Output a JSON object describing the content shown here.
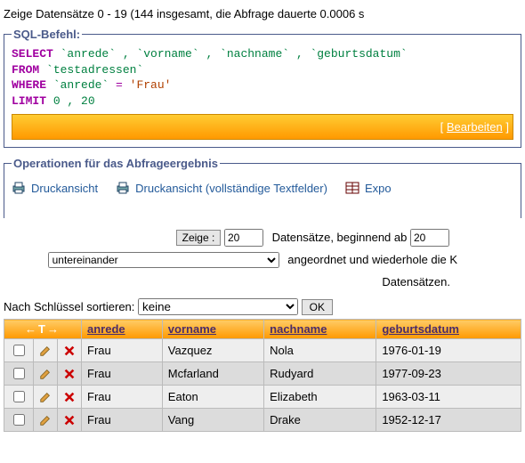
{
  "summary": "Zeige Datensätze 0 - 19 (144 insgesamt, die Abfrage dauerte 0.0006 s",
  "sql_box": {
    "legend": "SQL-Befehl:",
    "kw_select": "SELECT",
    "fields_part": " `anrede` , `vorname` , `nachname` , `geburtsdatum`",
    "kw_from": "FROM",
    "from_ident": " `testadressen`",
    "kw_where": "WHERE",
    "where_ident": " `anrede` ",
    "where_op": "=",
    "where_str": " 'Frau'",
    "kw_limit": "LIMIT",
    "limit_vals": " 0 , 20",
    "edit_bracket_open": "[ ",
    "edit_link": "Bearbeiten",
    "edit_bracket_close": " ]"
  },
  "ops": {
    "legend": "Operationen für das Abfrageergebnis",
    "print": "Druckansicht",
    "print_full": "Druckansicht (vollständige Textfelder)",
    "export": "Expo"
  },
  "nav": {
    "zeige_label": "Zeige :",
    "zeige_value": "20",
    "rows_prefix": "Datensätze, beginnend ab",
    "start_value": "20",
    "mode_value": "untereinander",
    "rest1": "angeordnet und wiederhole die K",
    "rest2": "Datensätzen."
  },
  "sort": {
    "label": "Nach Schlüssel sortieren:",
    "value": "keine",
    "ok": "OK"
  },
  "table": {
    "arrow_header": "←T→",
    "cols": [
      "anrede",
      "vorname",
      "nachname",
      "geburtsdatum"
    ],
    "rows": [
      {
        "anrede": "Frau",
        "vorname": "Vazquez",
        "nachname": "Nola",
        "geburtsdatum": "1976-01-19"
      },
      {
        "anrede": "Frau",
        "vorname": "Mcfarland",
        "nachname": "Rudyard",
        "geburtsdatum": "1977-09-23"
      },
      {
        "anrede": "Frau",
        "vorname": "Eaton",
        "nachname": "Elizabeth",
        "geburtsdatum": "1963-03-11"
      },
      {
        "anrede": "Frau",
        "vorname": "Vang",
        "nachname": "Drake",
        "geburtsdatum": "1952-12-17"
      }
    ]
  }
}
